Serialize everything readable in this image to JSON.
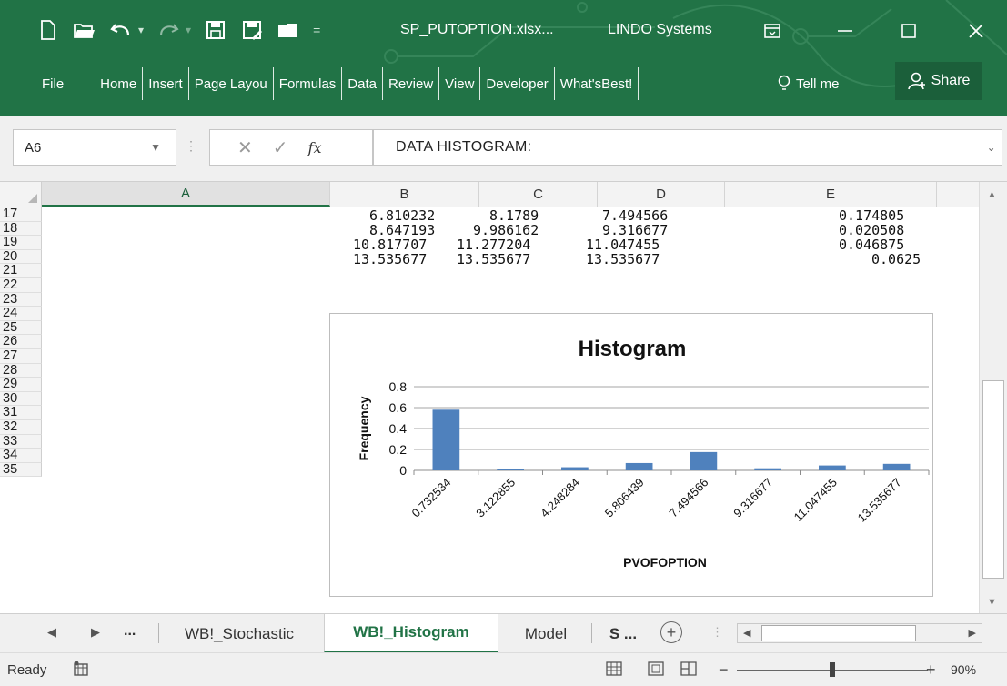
{
  "window": {
    "doc_title": "SP_PUTOPTION.xlsx...",
    "app_title": "LINDO Systems"
  },
  "menu": {
    "file": "File",
    "items": [
      "Home",
      "Insert",
      "Page Layou",
      "Formulas",
      "Data",
      "Review",
      "View",
      "Developer",
      "What'sBest!"
    ],
    "tell_me": "Tell me",
    "share": "Share"
  },
  "formula_bar": {
    "name_box": "A6",
    "formula": "DATA HISTOGRAM:"
  },
  "columns": [
    "A",
    "B",
    "C",
    "D",
    "E"
  ],
  "rows": [
    "17",
    "18",
    "19",
    "20",
    "21",
    "22",
    "23",
    "24",
    "25",
    "26",
    "27",
    "28",
    "29",
    "30",
    "31",
    "32",
    "33",
    "34",
    "35"
  ],
  "cells": [
    {
      "b": "6.810232",
      "c": "8.1789",
      "d": "7.494566",
      "e": "0.174805"
    },
    {
      "b": "8.647193",
      "c": "9.986162",
      "d": "9.316677",
      "e": "0.020508"
    },
    {
      "b": "10.817707",
      "c": "11.277204",
      "d": "11.047455",
      "e": "0.046875"
    },
    {
      "b": "13.535677",
      "c": "13.535677",
      "d": "13.535677",
      "e": "0.0625"
    }
  ],
  "chart_data": {
    "type": "bar",
    "title": "Histogram",
    "xlabel": "PVOFOPTION",
    "ylabel": "Frequency",
    "categories": [
      "0.732534",
      "3.122855",
      "4.248284",
      "5.806439",
      "7.494566",
      "9.316677",
      "11.047455",
      "13.535677"
    ],
    "values": [
      0.58,
      0.015,
      0.03,
      0.07,
      0.175,
      0.02,
      0.047,
      0.0625
    ],
    "yticks": [
      "0",
      "0.2",
      "0.4",
      "0.6",
      "0.8"
    ],
    "ylim": [
      0,
      0.8
    ],
    "grid": true,
    "bar_color": "#4f81bd"
  },
  "sheet_tabs": {
    "more_left": "...",
    "tabs": [
      "WB!_Stochastic",
      "WB!_Histogram",
      "Model",
      "S ..."
    ],
    "active": "WB!_Histogram"
  },
  "status": {
    "ready": "Ready",
    "zoom": "90%"
  },
  "colors": {
    "ribbon": "#217346",
    "accent": "#217346"
  }
}
